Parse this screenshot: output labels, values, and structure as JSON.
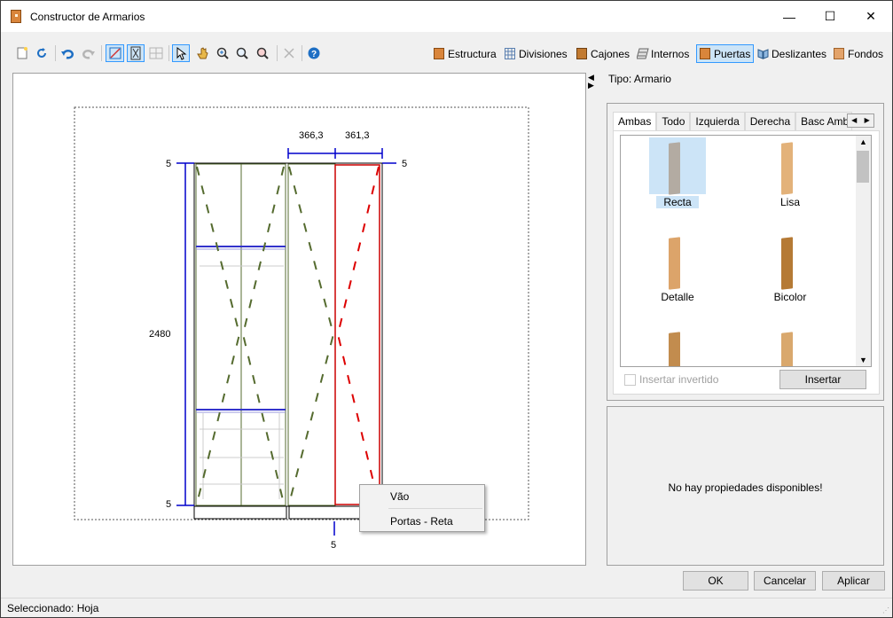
{
  "window": {
    "title": "Constructor de Armarios",
    "minimize": "—",
    "maximize": "☐",
    "close": "✕"
  },
  "toolbar": {
    "icons": [
      "new-icon",
      "refresh-icon",
      "undo-icon",
      "redo-icon",
      "edit-shape-icon",
      "select-frame-icon",
      "grid-icon",
      "pointer-icon",
      "hand-icon",
      "zoom-fit-icon",
      "zoom-in-icon",
      "zoom-icon",
      "delete-icon",
      "help-icon"
    ],
    "buttons": [
      {
        "label": "Estructura",
        "icon": "structure-icon"
      },
      {
        "label": "Divisiones",
        "icon": "divisions-icon"
      },
      {
        "label": "Cajones",
        "icon": "drawers-icon"
      },
      {
        "label": "Internos",
        "icon": "internals-icon"
      },
      {
        "label": "Puertas",
        "icon": "doors-icon",
        "active": true
      },
      {
        "label": "Deslizantes",
        "icon": "sliding-icon"
      },
      {
        "label": "Fondos",
        "icon": "backs-icon"
      }
    ]
  },
  "drawing": {
    "dim_top_left": "366,3",
    "dim_top_right": "361,3",
    "dim_height": "2480",
    "dim_top_edge_left": "5",
    "dim_top_edge_right": "5",
    "dim_bottom_edge_left": "5",
    "dim_bottom": "5"
  },
  "context_menu": {
    "items": [
      "Vão",
      "Portas - Reta"
    ]
  },
  "right_panel": {
    "tipo": "Tipo: Armario",
    "tabs": [
      "Ambas",
      "Todo",
      "Izquierda",
      "Derecha",
      "Basc Amba"
    ],
    "selected_tab": "Ambas",
    "items": [
      {
        "label": "Recta",
        "selected": true,
        "color": "#b3aba2"
      },
      {
        "label": "Lisa",
        "selected": false,
        "color": "#e3b27a"
      },
      {
        "label": "Detalle",
        "selected": false,
        "color": "#dca46a"
      },
      {
        "label": "Bicolor",
        "selected": false,
        "color": "#b57a35"
      },
      {
        "label": "",
        "selected": false,
        "color": "#c28c4e"
      },
      {
        "label": "",
        "selected": false,
        "color": "#d9a86d"
      }
    ],
    "checkbox_label": "Insertar invertido",
    "insert_button": "Insertar",
    "no_props": "No hay propiedades disponibles!"
  },
  "dialog_buttons": {
    "ok": "OK",
    "cancel": "Cancelar",
    "apply": "Aplicar"
  },
  "status": {
    "text": "Seleccionado: Hoja"
  },
  "colors": {
    "accent": "#3399ff",
    "dim_blue": "#0000ff",
    "door_green": "#556b2f",
    "door_red": "#dd0000",
    "selection": "#cce4f7"
  }
}
